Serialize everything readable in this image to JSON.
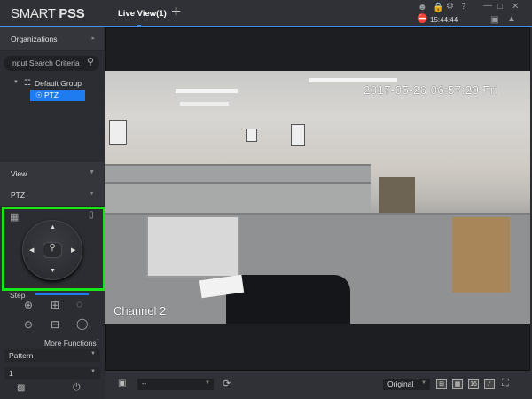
{
  "app": {
    "logo_light": "SMART ",
    "logo_bold": "PSS",
    "tab": "Live View(1)",
    "add_tab": "+",
    "clock": "15:44:44"
  },
  "sidebar": {
    "organizations": "Organizations",
    "search_placeholder": "nput Search Criteria",
    "tree_group": "Default Group",
    "tree_device": "PTZ",
    "view": "View",
    "ptz": "PTZ",
    "step": "Step",
    "more_functions": "More Functions",
    "pattern": "Pattern",
    "pattern_value": "1"
  },
  "video": {
    "timestamp": "2017-05-26 06:57:20 Fri",
    "channel": "Channel 2"
  },
  "bottombar": {
    "stream": "--",
    "scale": "Original",
    "grid16": "16"
  },
  "colors": {
    "accent": "#1e7bf0",
    "highlight": "#19e619"
  }
}
